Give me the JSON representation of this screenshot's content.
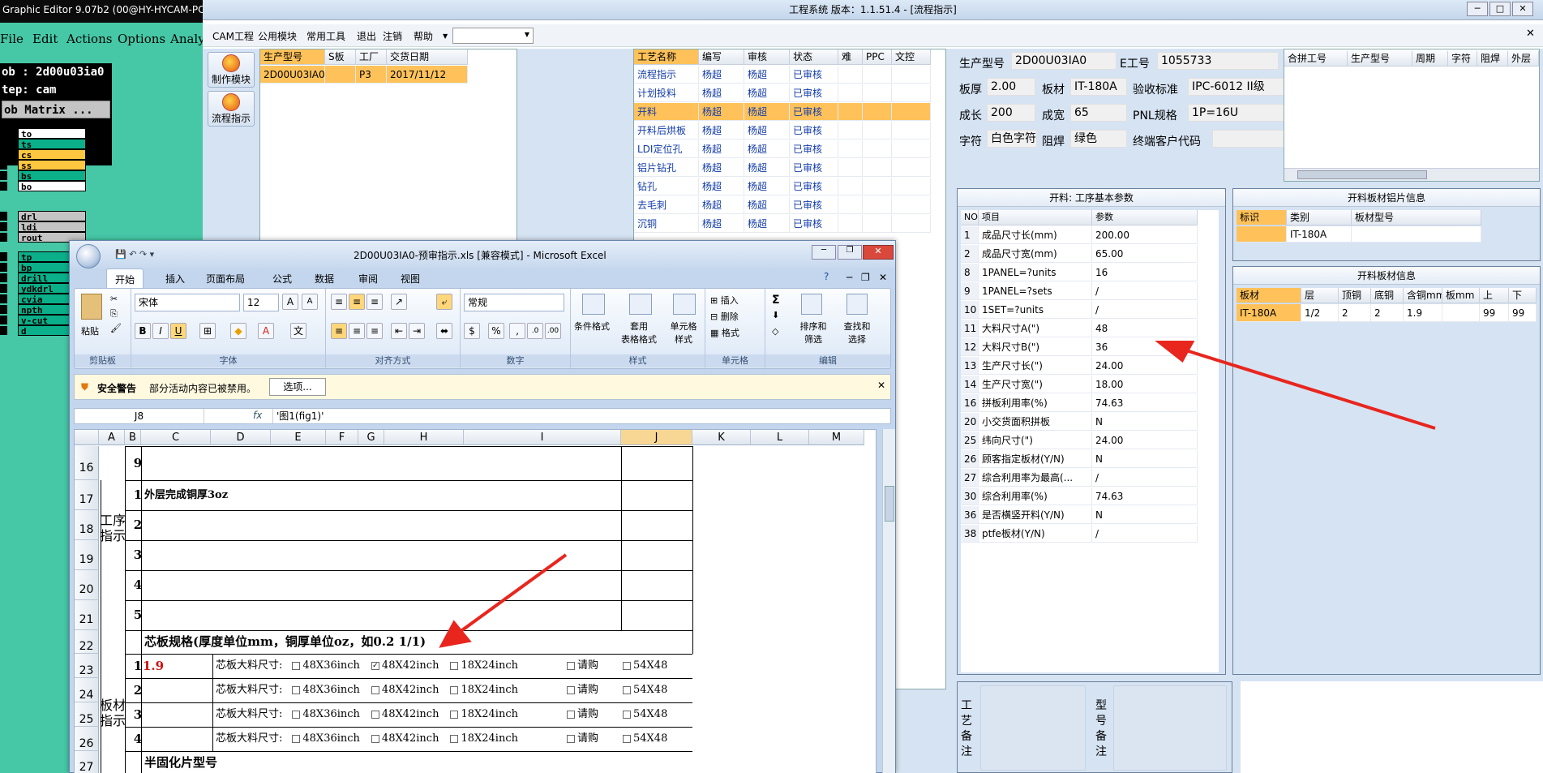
{
  "graphic_editor": {
    "title": "Graphic Editor 9.07b2 (00@HY-HYCAM-PC",
    "menu": [
      "File",
      "Edit",
      "Actions",
      "Options",
      "Analy"
    ],
    "job": "ob : 2d00u03ia0",
    "step": "tep: cam",
    "matrix_btn": "ob Matrix ...",
    "layers": [
      {
        "name": "to",
        "color": "#ffffff"
      },
      {
        "name": "ts",
        "color": "#0bb08a"
      },
      {
        "name": "cs",
        "color": "#ffc640"
      },
      {
        "name": "ss",
        "color": "#ffc640"
      },
      {
        "name": "bs",
        "color": "#0bb08a"
      },
      {
        "name": "bo",
        "color": "#ffffff"
      },
      {
        "name": "drl",
        "color": "#c4c4c4"
      },
      {
        "name": "ldi",
        "color": "#c4c4c4"
      },
      {
        "name": "rout",
        "color": "#c4c4c4"
      },
      {
        "name": "tp",
        "color": "#0bb08a"
      },
      {
        "name": "bp",
        "color": "#0bb08a"
      },
      {
        "name": "drill",
        "color": "#0bb08a"
      },
      {
        "name": "ydkdrl",
        "color": "#0bb08a"
      },
      {
        "name": "cvia",
        "color": "#0bb08a"
      },
      {
        "name": "npth",
        "color": "#0bb08a"
      },
      {
        "name": "v-cut",
        "color": "#0bb08a"
      },
      {
        "name": "d",
        "color": "#0bb08a"
      }
    ]
  },
  "cam": {
    "title": "工程系统  版本：1.1.51.4 - [流程指示]",
    "menu": [
      "CAM工程",
      "公用模块",
      "常用工具",
      "退出",
      "注销",
      "帮助"
    ],
    "nav": [
      "制作模块",
      "流程指示"
    ],
    "orders": {
      "headers": [
        "生产型号",
        "S板",
        "工厂",
        "交货日期"
      ],
      "row": [
        "2D00U03IA0",
        "",
        "P3",
        "2017/11/12"
      ]
    },
    "process": {
      "headers": [
        "工艺名称",
        "编写",
        "审核",
        "状态",
        "难",
        "PPC",
        "文控"
      ],
      "rows": [
        [
          "流程指示",
          "杨超",
          "杨超",
          "已审核"
        ],
        [
          "计划投料",
          "杨超",
          "杨超",
          "已审核"
        ],
        [
          "开料",
          "杨超",
          "杨超",
          "已审核"
        ],
        [
          "开料后烘板",
          "杨超",
          "杨超",
          "已审核"
        ],
        [
          "LDI定位孔",
          "杨超",
          "杨超",
          "已审核"
        ],
        [
          "铝片钻孔",
          "杨超",
          "杨超",
          "已审核"
        ],
        [
          "钻孔",
          "杨超",
          "杨超",
          "已审核"
        ],
        [
          "去毛刺",
          "杨超",
          "杨超",
          "已审核"
        ],
        [
          "沉铜",
          "杨超",
          "杨超",
          "已审核"
        ]
      ]
    },
    "info": {
      "model_label": "生产型号",
      "model": "2D00U03IA0",
      "eno_label": "E工号",
      "eno": "1055733",
      "thick_label": "板厚",
      "thick": "2.00",
      "mat_label": "板材",
      "mat": "IT-180A",
      "std_label": "验收标准",
      "std": "IPC-6012 II级",
      "len_label": "成长",
      "len": "200",
      "wid_label": "成宽",
      "wid": "65",
      "pnl_label": "PNL规格",
      "pnl": "1P=16U",
      "char_label": "字符",
      "char": "白色字符",
      "mask_label": "阻焊",
      "mask": "绿色",
      "cust_label": "终端客户代码",
      "cust": ""
    },
    "merge_headers": [
      "合拼工号",
      "生产型号",
      "周期",
      "字符",
      "阻焊",
      "外层"
    ],
    "params": {
      "title": "开料: 工序基本参数",
      "headers": [
        "NO",
        "项目",
        "参数"
      ],
      "rows": [
        [
          "1",
          "成品尺寸长(mm)",
          "200.00"
        ],
        [
          "2",
          "成品尺寸宽(mm)",
          "65.00"
        ],
        [
          "8",
          "1PANEL=?units",
          "16"
        ],
        [
          "9",
          "1PANEL=?sets",
          "/"
        ],
        [
          "10",
          "1SET=?units",
          "/"
        ],
        [
          "11",
          "大料尺寸A(\")",
          "48"
        ],
        [
          "12",
          "大料尺寸B(\")",
          "36"
        ],
        [
          "13",
          "生产尺寸长(\")",
          "24.00"
        ],
        [
          "14",
          "生产尺寸宽(\")",
          "18.00"
        ],
        [
          "16",
          "拼板利用率(%)",
          "74.63"
        ],
        [
          "20",
          "小交货面积拼板",
          "N"
        ],
        [
          "25",
          "纬向尺寸(\")",
          "24.00"
        ],
        [
          "26",
          "顾客指定板材(Y/N)",
          "N"
        ],
        [
          "27",
          "综合利用率为最高(...",
          "/"
        ],
        [
          "30",
          "综合利用率(%)",
          "74.63"
        ],
        [
          "36",
          "是否横竖开料(Y/N)",
          "N"
        ],
        [
          "38",
          "ptfe板材(Y/N)",
          "/"
        ]
      ]
    },
    "foil": {
      "title": "开料板材铝片信息",
      "headers": [
        "标识",
        "类别",
        "板材型号"
      ],
      "row": [
        "",
        "IT-180A",
        ""
      ]
    },
    "board": {
      "title": "开料板材信息",
      "headers": [
        "板材",
        "层",
        "顶铜",
        "底铜",
        "含铜mm",
        "板mm",
        "上",
        "下"
      ],
      "row": [
        "IT-180A",
        "1/2",
        "2",
        "2",
        "1.9",
        "",
        "99",
        "99"
      ]
    },
    "remark1": "工艺备注",
    "remark2": "型号备注"
  },
  "excel": {
    "title": "2D00U03IA0-预审指示.xls  [兼容模式] - Microsoft Excel",
    "tabs": [
      "开始",
      "插入",
      "页面布局",
      "公式",
      "数据",
      "审阅",
      "视图"
    ],
    "font": "宋体",
    "size": "12",
    "numfmt": "常规",
    "groups": [
      "剪贴板",
      "字体",
      "对齐方式",
      "数字",
      "样式",
      "单元格",
      "编辑"
    ],
    "paste": "粘贴",
    "style_btns": [
      "条件格式",
      "套用\n表格格式",
      "单元格\n样式"
    ],
    "cell_btns": [
      "插入",
      "删除",
      "格式"
    ],
    "edit_btns": [
      "排序和\n筛选",
      "查找和\n选择"
    ],
    "warn_title": "安全警告",
    "warn_text": "部分活动内容已被禁用。",
    "warn_btn": "选项...",
    "namebox": "J8",
    "formula": "'图1(fig1)'",
    "cols": [
      "A",
      "B",
      "C",
      "D",
      "E",
      "F",
      "G",
      "H",
      "I",
      "J",
      "K",
      "L",
      "M"
    ],
    "rows": [
      "16",
      "17",
      "18",
      "19",
      "20",
      "21",
      "22",
      "23",
      "24",
      "25",
      "26",
      "27"
    ],
    "proc_label": "工序\n指示",
    "board_label": "板材\n指示",
    "r16": "9",
    "r17n": "1",
    "r17t": "外层完成铜厚3oz",
    "r18": "2",
    "r19": "3",
    "r20": "4",
    "r21": "5",
    "r22": "芯板规格(厚度单位mm，铜厚单位oz，如0.2 1/1)",
    "core_rows": [
      {
        "n": "1",
        "v": "1.9",
        "checked": true
      },
      {
        "n": "2",
        "v": "",
        "checked": false
      },
      {
        "n": "3",
        "v": "",
        "checked": false
      },
      {
        "n": "4",
        "v": "",
        "checked": false
      }
    ],
    "core_label": "芯板大料尺寸:",
    "opt1": "48X36inch",
    "opt2": "48X42inch",
    "opt3": "18X24inch",
    "opt4": "请购",
    "opt5": "54X48",
    "r27": "半固化片型号"
  },
  "colors": {
    "arrow": "#e8261e",
    "selected": "#ffc25a",
    "accent": "#1f4ea0"
  }
}
